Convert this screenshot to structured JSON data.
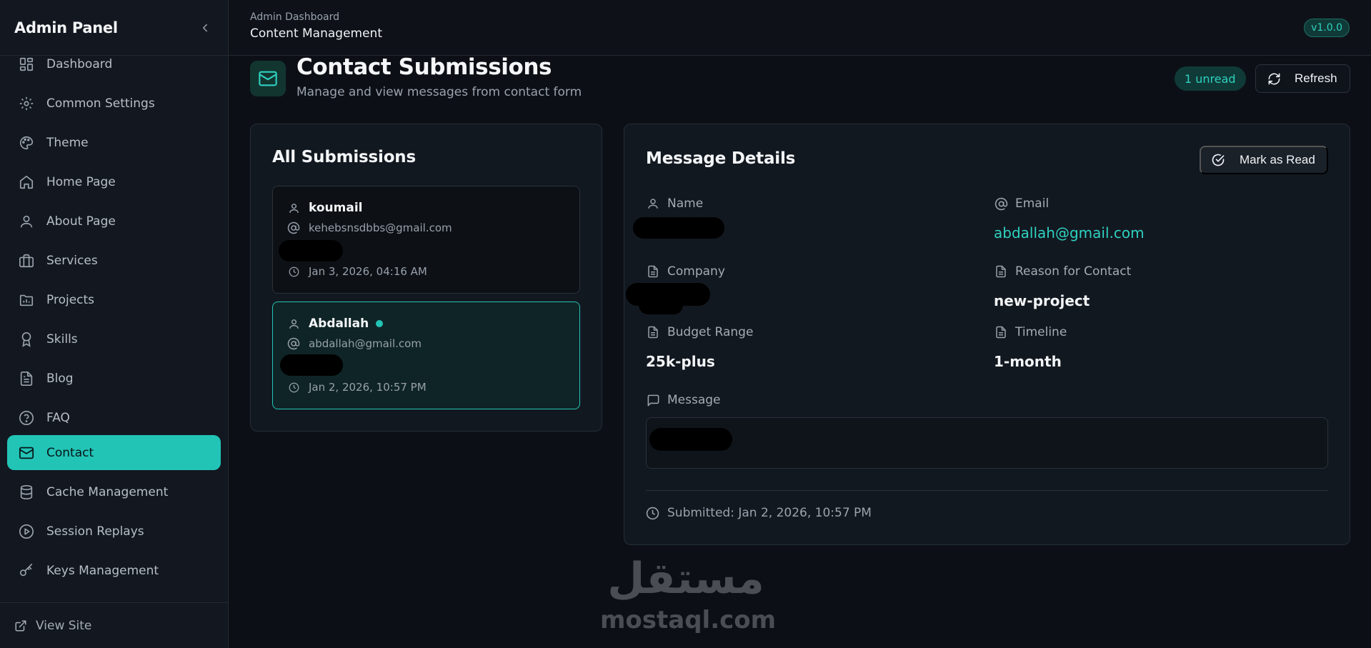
{
  "sidebar": {
    "title": "Admin Panel",
    "items": [
      {
        "label": "Dashboard",
        "icon": "dashboard-icon"
      },
      {
        "label": "Common Settings",
        "icon": "gear-icon"
      },
      {
        "label": "Theme",
        "icon": "palette-icon"
      },
      {
        "label": "Home Page",
        "icon": "home-icon"
      },
      {
        "label": "About Page",
        "icon": "user-icon"
      },
      {
        "label": "Services",
        "icon": "briefcase-icon"
      },
      {
        "label": "Projects",
        "icon": "folder-icon"
      },
      {
        "label": "Skills",
        "icon": "award-icon"
      },
      {
        "label": "Blog",
        "icon": "document-icon"
      },
      {
        "label": "FAQ",
        "icon": "help-circle-icon"
      },
      {
        "label": "Contact",
        "icon": "mail-icon",
        "active": true
      },
      {
        "label": "Cache Management",
        "icon": "database-icon"
      },
      {
        "label": "Session Replays",
        "icon": "play-circle-icon"
      },
      {
        "label": "Keys Management",
        "icon": "key-icon"
      }
    ],
    "footer_link": "View Site"
  },
  "topbar": {
    "breadcrumb": "Admin Dashboard",
    "section": "Content Management",
    "version": "v1.0.0"
  },
  "page": {
    "title": "Contact Submissions",
    "subtitle": "Manage and view messages from contact form",
    "unread_badge": "1 unread",
    "refresh_label": "Refresh"
  },
  "submissions": {
    "title": "All Submissions",
    "items": [
      {
        "name": "koumail",
        "email": "kehebsnsdbbs@gmail.com",
        "date": "Jan 3, 2026, 04:16 AM",
        "unread": false
      },
      {
        "name": "Abdallah",
        "email": "abdallah@gmail.com",
        "date": "Jan 2, 2026, 10:57 PM",
        "unread": true
      }
    ]
  },
  "details": {
    "title": "Message Details",
    "mark_read_label": "Mark as Read",
    "name_label": "Name",
    "email_label": "Email",
    "email_value": "abdallah@gmail.com",
    "company_label": "Company",
    "reason_label": "Reason for Contact",
    "reason_value": "new-project",
    "budget_label": "Budget Range",
    "budget_value": "25k-plus",
    "timeline_label": "Timeline",
    "timeline_value": "1-month",
    "message_label": "Message",
    "submitted": "Submitted: Jan 2, 2026, 10:57 PM"
  },
  "watermark": {
    "arabic": "مستقل",
    "latin": "mostaql.com"
  },
  "colors": {
    "accent": "#22c4b6",
    "background": "#0c1016",
    "card": "#121820"
  }
}
